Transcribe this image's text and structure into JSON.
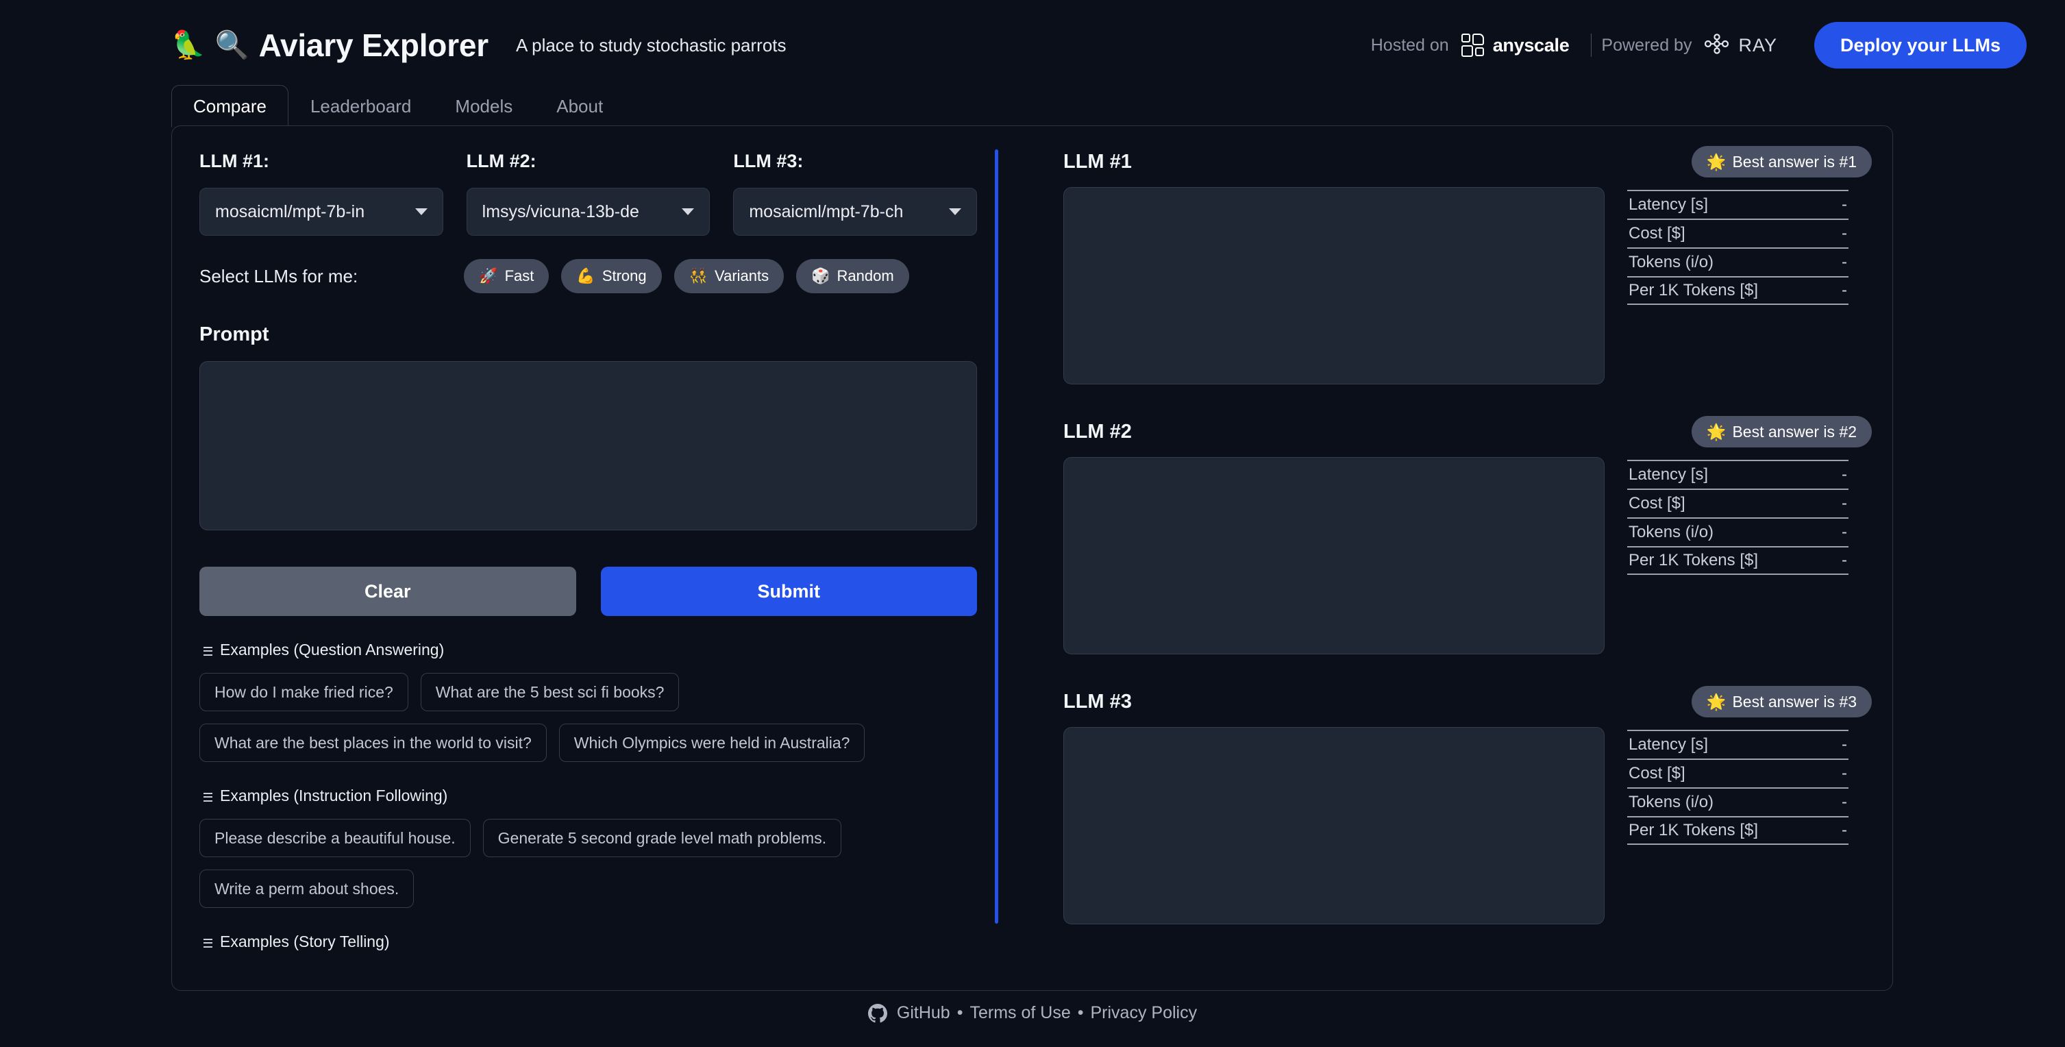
{
  "header": {
    "brand_emoji_parrot": "🦜",
    "brand_emoji_search": "🔍",
    "title": "Aviary Explorer",
    "subtitle": "A place to study stochastic parrots",
    "hosted_label": "Hosted on",
    "anyscale_name": "anyscale",
    "separator": "|",
    "powered_label": "Powered by",
    "ray_name": "RAY",
    "deploy_button": "Deploy your LLMs",
    "accent_color": "#2552e8"
  },
  "tabs": [
    {
      "label": "Compare",
      "active": true
    },
    {
      "label": "Leaderboard",
      "active": false
    },
    {
      "label": "Models",
      "active": false
    },
    {
      "label": "About",
      "active": false
    }
  ],
  "compare": {
    "llm_selectors": [
      {
        "label": "LLM #1:",
        "value": "mosaicml/mpt-7b-in"
      },
      {
        "label": "LLM #2:",
        "value": "lmsys/vicuna-13b-de"
      },
      {
        "label": "LLM #3:",
        "value": "mosaicml/mpt-7b-ch"
      }
    ],
    "select_for_me_label": "Select LLMs for me:",
    "select_pills": [
      {
        "emoji": "🚀",
        "label": "Fast"
      },
      {
        "emoji": "💪",
        "label": "Strong"
      },
      {
        "emoji": "👯",
        "label": "Variants"
      },
      {
        "emoji": "🎲",
        "label": "Random"
      }
    ],
    "prompt_label": "Prompt",
    "prompt_value": "",
    "prompt_placeholder": "",
    "clear_button": "Clear",
    "submit_button": "Submit",
    "example_groups": [
      {
        "title": "Examples (Question Answering)",
        "rows": [
          [
            "How do I make fried rice?",
            "What are the 5 best sci fi books?"
          ],
          [
            "What are the best places in the world to visit?",
            "Which Olympics were held in Australia?"
          ]
        ]
      },
      {
        "title": "Examples (Instruction Following)",
        "rows": [
          [
            "Please describe a beautiful house.",
            "Generate 5 second grade level math problems."
          ],
          [
            "Write a perm about shoes."
          ]
        ]
      },
      {
        "title": "Examples (Story Telling)",
        "rows": []
      }
    ]
  },
  "results": [
    {
      "title": "LLM #1",
      "best_emoji": "🌟",
      "best_label": "Best answer is #1",
      "output": "",
      "metrics": [
        {
          "label": "Latency [s]",
          "value": "-"
        },
        {
          "label": "Cost [$]",
          "value": "-"
        },
        {
          "label": "Tokens (i/o)",
          "value": "-"
        },
        {
          "label": "Per 1K Tokens [$]",
          "value": "-"
        }
      ]
    },
    {
      "title": "LLM #2",
      "best_emoji": "🌟",
      "best_label": "Best answer is #2",
      "output": "",
      "metrics": [
        {
          "label": "Latency [s]",
          "value": "-"
        },
        {
          "label": "Cost [$]",
          "value": "-"
        },
        {
          "label": "Tokens (i/o)",
          "value": "-"
        },
        {
          "label": "Per 1K Tokens [$]",
          "value": "-"
        }
      ]
    },
    {
      "title": "LLM #3",
      "best_emoji": "🌟",
      "best_label": "Best answer is #3",
      "output": "",
      "metrics": [
        {
          "label": "Latency [s]",
          "value": "-"
        },
        {
          "label": "Cost [$]",
          "value": "-"
        },
        {
          "label": "Tokens (i/o)",
          "value": "-"
        },
        {
          "label": "Per 1K Tokens [$]",
          "value": "-"
        }
      ]
    }
  ],
  "footer": {
    "github_label": "GitHub",
    "bullet1": "•",
    "terms_label": "Terms of Use",
    "bullet2": "•",
    "privacy_label": "Privacy Policy"
  }
}
